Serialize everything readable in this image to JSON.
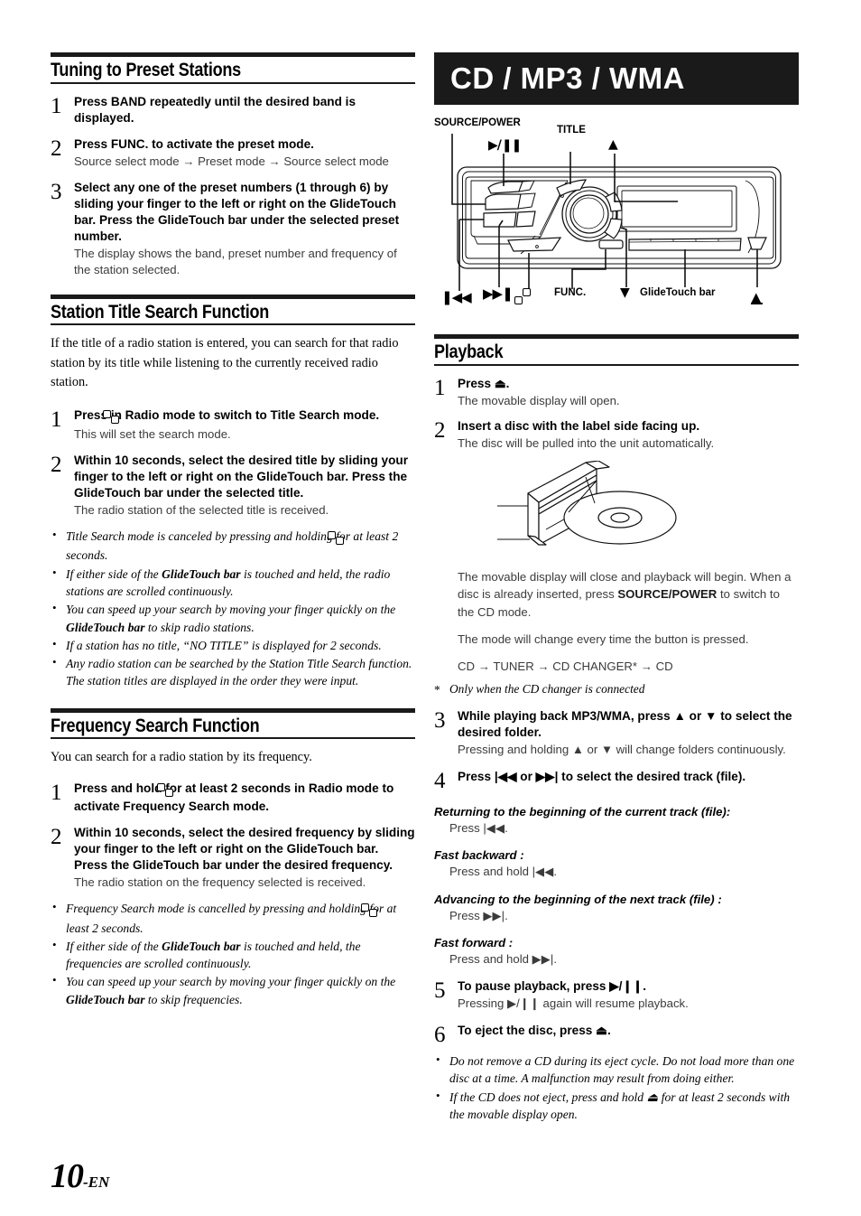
{
  "page": {
    "number": "10",
    "suffix": "-EN"
  },
  "left": {
    "section1": {
      "heading": "Tuning to Preset Stations",
      "steps": [
        {
          "num": "1",
          "title_parts": [
            "Press ",
            "BAND",
            " repeatedly until the desired band is displayed."
          ]
        },
        {
          "num": "2",
          "title_parts": [
            "Press ",
            "FUNC.",
            " to activate the preset mode."
          ],
          "sub": "Source select mode → Preset mode → Source select mode"
        },
        {
          "num": "3",
          "title": "Select any one of the preset numbers (1 through 6) by sliding your finger to the left or right on the GlideTouch bar. Press the GlideTouch bar under the selected preset number.",
          "sub": "The display shows the band, preset number and frequency of the station selected."
        }
      ]
    },
    "section2": {
      "heading": "Station Title Search Function",
      "intro": "If the title of a radio station is entered, you can search for that radio station by its title while listening to the currently received radio station.",
      "step1_a": "Press ",
      "step1_b": " in Radio mode to switch to Title Search mode.",
      "step1_sub": "This will set the search mode.",
      "step2_title": "Within 10 seconds, select the desired title by sliding your finger to the left or right on the GlideTouch bar. Press the GlideTouch bar under the selected title.",
      "step2_sub": "The radio station of the selected title is received.",
      "notes": [
        "Title Search mode is canceled by pressing and holding □ for at least 2 seconds.",
        "If either side of the GlideTouch bar is touched and held, the radio stations are scrolled continuously.",
        "You can speed up your search by moving your finger quickly on the GlideTouch bar to skip radio stations.",
        "If a station has no title, “NO TITLE” is displayed for 2 seconds.",
        "Any radio station can be searched by the Station Title Search function. The station titles are displayed in the order they were input."
      ]
    },
    "section3": {
      "heading": "Frequency Search Function",
      "intro": "You can search for a radio station by its frequency.",
      "step1_a": "Press and hold ",
      "step1_b": " for at least 2 seconds in Radio mode to activate Frequency Search mode.",
      "step2_title": "Within 10 seconds, select the desired frequency by sliding your finger to the left or right on the GlideTouch bar. Press the GlideTouch bar under the desired frequency.",
      "step2_sub": "The radio station on the frequency selected is received.",
      "notes": [
        "Frequency Search mode is cancelled by pressing and holding □ for at least 2 seconds.",
        "If either side of the GlideTouch bar is touched and held, the frequencies are scrolled continuously.",
        "You can speed up your search by moving your finger quickly on the GlideTouch bar to skip frequencies."
      ]
    }
  },
  "right": {
    "banner_title": "CD / MP3 / WMA",
    "diagram": {
      "labels": {
        "source_power": "SOURCE/POWER",
        "title": "TITLE",
        "play_pause": "▶/❙❙",
        "up": "▲",
        "prev": "|◀◀",
        "next": "▶▶|",
        "title_icon": "title-stack-icon",
        "func": "FUNC.",
        "down": "▼",
        "glidetouch": "GlideTouch bar",
        "eject": "⏏"
      }
    },
    "playback": {
      "heading": "Playback",
      "steps": [
        {
          "num": "1",
          "title": "Press ⏏.",
          "sub": "The movable display will open."
        },
        {
          "num": "2",
          "title": "Insert a disc with the label side facing up.",
          "sub": "The disc will be pulled into the unit automatically."
        }
      ],
      "after_disc": {
        "p1": "The movable display will close and playback will begin. When a disc is already inserted, press SOURCE/POWER to switch to the CD mode.",
        "p2": "The mode will change every time the button is pressed.",
        "p3": "CD → TUNER → CD CHANGER* → CD",
        "footnote_star": "*",
        "footnote": "Only when the CD changer is connected"
      },
      "step3": {
        "num": "3",
        "title": "While playing back MP3/WMA, press ▲ or ▼ to select the desired folder.",
        "sub": "Pressing and holding ▲ or ▼ will change folders continuously."
      },
      "step4": {
        "num": "4",
        "title": "Press |◀◀ or ▶▶| to select the desired track (file)."
      },
      "modes": [
        {
          "head": "Returning to the beginning of the current track (file):",
          "body": "Press |◀◀."
        },
        {
          "head": "Fast backward :",
          "body": "Press and hold |◀◀."
        },
        {
          "head": "Advancing to the beginning of the next track (file) :",
          "body": "Press ▶▶|."
        },
        {
          "head": "Fast forward :",
          "body": "Press and hold ▶▶|."
        }
      ],
      "step5": {
        "num": "5",
        "title": "To pause playback, press ▶/❙❙.",
        "sub": "Pressing ▶/❙❙ again will resume playback."
      },
      "step6": {
        "num": "6",
        "title": "To eject the disc, press ⏏."
      },
      "notes": [
        "Do not remove a CD during its eject cycle. Do not load more than one disc at a time. A malfunction may result from doing either.",
        "If the CD does not eject, press and hold ⏏ for at least 2 seconds with the movable display open."
      ]
    }
  },
  "colors": {
    "ink": "#1a1a1a",
    "subtext": "#3b3b3b",
    "banner_bg": "#1a1a1a",
    "banner_fg": "#ffffff"
  }
}
